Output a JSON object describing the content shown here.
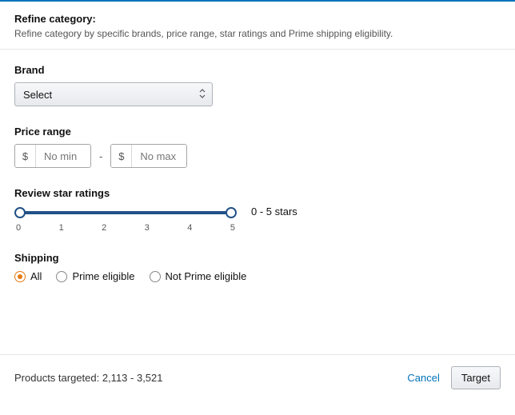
{
  "header": {
    "title": "Refine category:",
    "description": "Refine category by specific brands, price range, star ratings and Prime shipping eligibility."
  },
  "brand": {
    "label": "Brand",
    "selected": "Select"
  },
  "price": {
    "label": "Price range",
    "currency": "$",
    "min_placeholder": "No min",
    "max_placeholder": "No max",
    "separator": "-"
  },
  "review": {
    "label": "Review star ratings",
    "ticks": [
      "0",
      "1",
      "2",
      "3",
      "4",
      "5"
    ],
    "readout": "0 - 5 stars"
  },
  "shipping": {
    "label": "Shipping",
    "options": {
      "all": "All",
      "prime": "Prime eligible",
      "not_prime": "Not Prime eligible"
    },
    "selected": "all"
  },
  "footer": {
    "products_text": "Products targeted: 2,113 - 3,521",
    "cancel": "Cancel",
    "target": "Target"
  }
}
